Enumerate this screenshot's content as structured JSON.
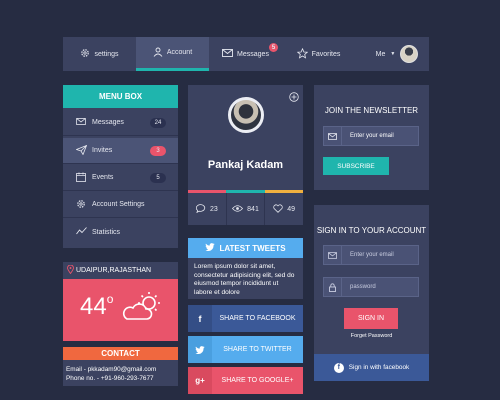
{
  "nav": {
    "settings": "settings",
    "account": "Account",
    "messages": "Messages",
    "messages_badge": "5",
    "favorites": "Favorites",
    "me": "Me"
  },
  "menu": {
    "title": "MENU BOX",
    "items": [
      {
        "label": "Messages",
        "count": "24"
      },
      {
        "label": "Invites",
        "count": "3"
      },
      {
        "label": "Events",
        "count": "5"
      },
      {
        "label": "Account Settings",
        "count": ""
      },
      {
        "label": "Statistics",
        "count": ""
      }
    ]
  },
  "weather": {
    "location": "UDAIPUR,RAJASTHAN",
    "temp": "44",
    "unit": "o"
  },
  "contact": {
    "title": "CONTACT",
    "email": "Email - pkkadam90@gmail.com",
    "phone": "Phone no. - +91-960-293-7677"
  },
  "profile": {
    "name": "Pankaj Kadam",
    "stats": {
      "comments": "23",
      "views": "841",
      "likes": "49"
    }
  },
  "tweets": {
    "title": "LATEST TWEETS",
    "text": "Lorem ipsum dolor sit amet, consectetur adipisicing elit, sed do eiusmod tempor incididunt ut labore et dolore"
  },
  "share": {
    "facebook": "SHARE TO FACEBOOK",
    "twitter": "SHARE TO TWITTER",
    "google": "SHARE TO GOOGLE+",
    "google_icon": "g+"
  },
  "newsletter": {
    "title": "JOIN THE NEWSLETTER",
    "email_placeholder": "Enter your email",
    "subscribe": "SUBSCRIBE"
  },
  "signin": {
    "title": "SIGN IN TO YOUR ACCOUNT",
    "email_placeholder": "Enter your email",
    "password_placeholder": "password",
    "button": "SIGN IN",
    "forgot": "Forget Password",
    "facebook": "Sign in with facebook"
  },
  "colors": {
    "accent": "#1fb5ad",
    "red": "#e9546b",
    "orange": "#f0683f",
    "facebook": "#3b5998",
    "twitter": "#55acee",
    "google": "#dd4b39"
  }
}
